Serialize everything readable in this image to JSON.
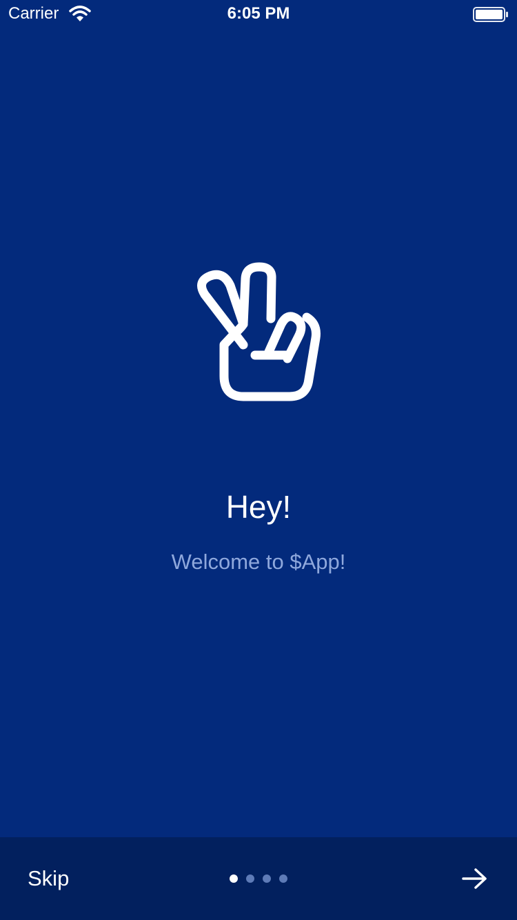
{
  "status_bar": {
    "carrier": "Carrier",
    "time": "6:05 PM",
    "wifi_icon": "wifi-icon",
    "battery_icon": "battery-icon"
  },
  "onboarding": {
    "hero_icon": "victory-hand-icon",
    "title": "Hey!",
    "subtitle": "Welcome to $App!"
  },
  "bottom_bar": {
    "skip_label": "Skip",
    "page_count": 4,
    "current_page": 1,
    "next_icon": "arrow-right-icon"
  },
  "colors": {
    "background": "#032A7C",
    "bottom_bar": "#02205E",
    "subtitle": "#8FA8DC",
    "dot_inactive": "#5E7BB7",
    "dot_active": "#FFFFFF"
  }
}
